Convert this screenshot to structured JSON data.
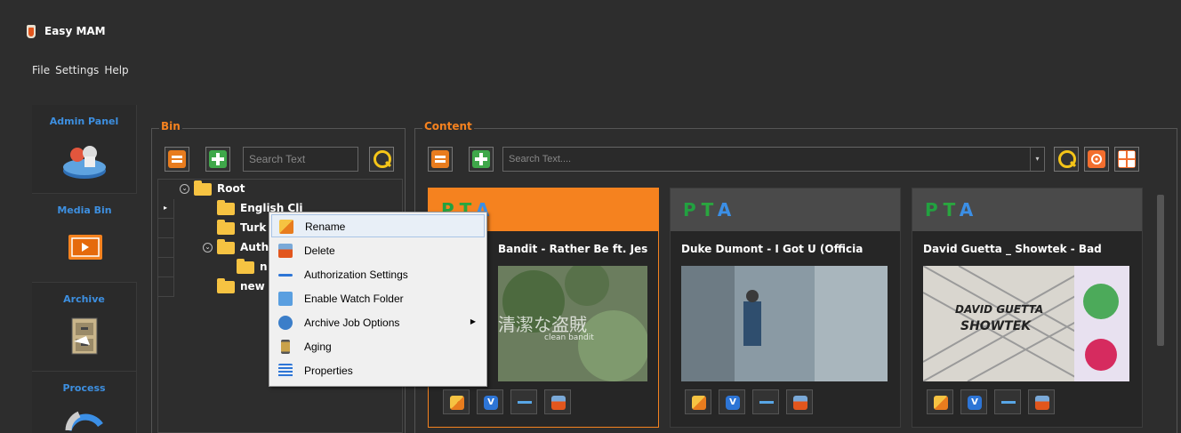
{
  "app": {
    "title": "Easy MAM"
  },
  "menu": [
    "File",
    "Settings",
    "Help"
  ],
  "nav": [
    {
      "label": "Admin Panel",
      "icon": "admin-panel-icon"
    },
    {
      "label": "Media Bin",
      "icon": "media-bin-icon"
    },
    {
      "label": "Archive",
      "icon": "archive-icon"
    },
    {
      "label": "Process",
      "icon": "process-icon"
    }
  ],
  "bin": {
    "legend": "Bin",
    "search_placeholder": "Search Text",
    "tree": [
      {
        "label": "Root"
      },
      {
        "label": "English Cli"
      },
      {
        "label": "Turk"
      },
      {
        "label": "Auth"
      },
      {
        "label": "n"
      },
      {
        "label": "new"
      }
    ]
  },
  "content": {
    "legend": "Content",
    "search_placeholder": "Search Text....",
    "cards": [
      {
        "badge": "P T A",
        "title": "Bandit - Rather Be ft. Jes",
        "thumb_text": "清潔な盗賊",
        "thumb_sub": "clean bandit"
      },
      {
        "badge": "P T A",
        "title": "Duke Dumont - I Got U (Officia"
      },
      {
        "badge": "P T A",
        "title": "David Guetta _ Showtek - Bad",
        "thumb_text": "DAVID GUETTA",
        "thumb_sub": "SHOWTEK"
      }
    ]
  },
  "context_menu": [
    {
      "label": "Rename",
      "icon": "rename-icon"
    },
    {
      "label": "Delete",
      "icon": "delete-icon"
    },
    {
      "label": "Authorization Settings",
      "icon": "key-icon"
    },
    {
      "label": "Enable Watch Folder",
      "icon": "watch-folder-icon"
    },
    {
      "label": "Archive Job Options",
      "icon": "archive-job-icon",
      "submenu": true
    },
    {
      "label": "Aging",
      "icon": "hourglass-icon"
    },
    {
      "label": "Properties",
      "icon": "properties-icon"
    }
  ],
  "colors": {
    "accent": "#f5821f",
    "nav_label": "#3d8fe0",
    "background": "#2d2d2d"
  }
}
